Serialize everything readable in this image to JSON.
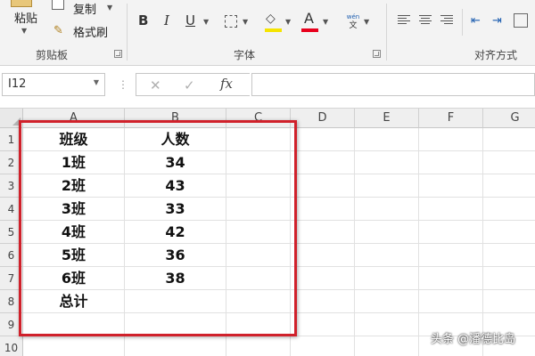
{
  "ribbon": {
    "clipboard": {
      "paste_label": "粘贴",
      "copy_label": "复制",
      "format_painter_label": "格式刷",
      "group_label": "剪贴板"
    },
    "font": {
      "bold_label": "B",
      "italic_label": "I",
      "underline_label": "U",
      "font_color_glyph": "A",
      "phonetic_top": "wén",
      "phonetic_glyph": "文",
      "group_label": "字体",
      "fill_color": "#f5e400",
      "font_color": "#e8001c"
    },
    "alignment": {
      "group_label": "对齐方式"
    }
  },
  "formula_bar": {
    "name_box": "I12",
    "cancel_glyph": "✕",
    "enter_glyph": "✓",
    "fx_label": "fx",
    "formula": ""
  },
  "sheet": {
    "columns": [
      "A",
      "B",
      "C",
      "D",
      "E",
      "F",
      "G"
    ],
    "rows": [
      "1",
      "2",
      "3",
      "4",
      "5",
      "6",
      "7",
      "8",
      "9",
      "10"
    ],
    "cells": [
      [
        "班级",
        "人数"
      ],
      [
        "1班",
        "34"
      ],
      [
        "2班",
        "43"
      ],
      [
        "3班",
        "33"
      ],
      [
        "4班",
        "42"
      ],
      [
        "5班",
        "36"
      ],
      [
        "6班",
        "38"
      ],
      [
        "总计",
        ""
      ],
      [
        "",
        ""
      ],
      [
        "",
        ""
      ]
    ],
    "highlight_color": "#d0212b"
  },
  "watermark": "头条 @潘德比岛"
}
